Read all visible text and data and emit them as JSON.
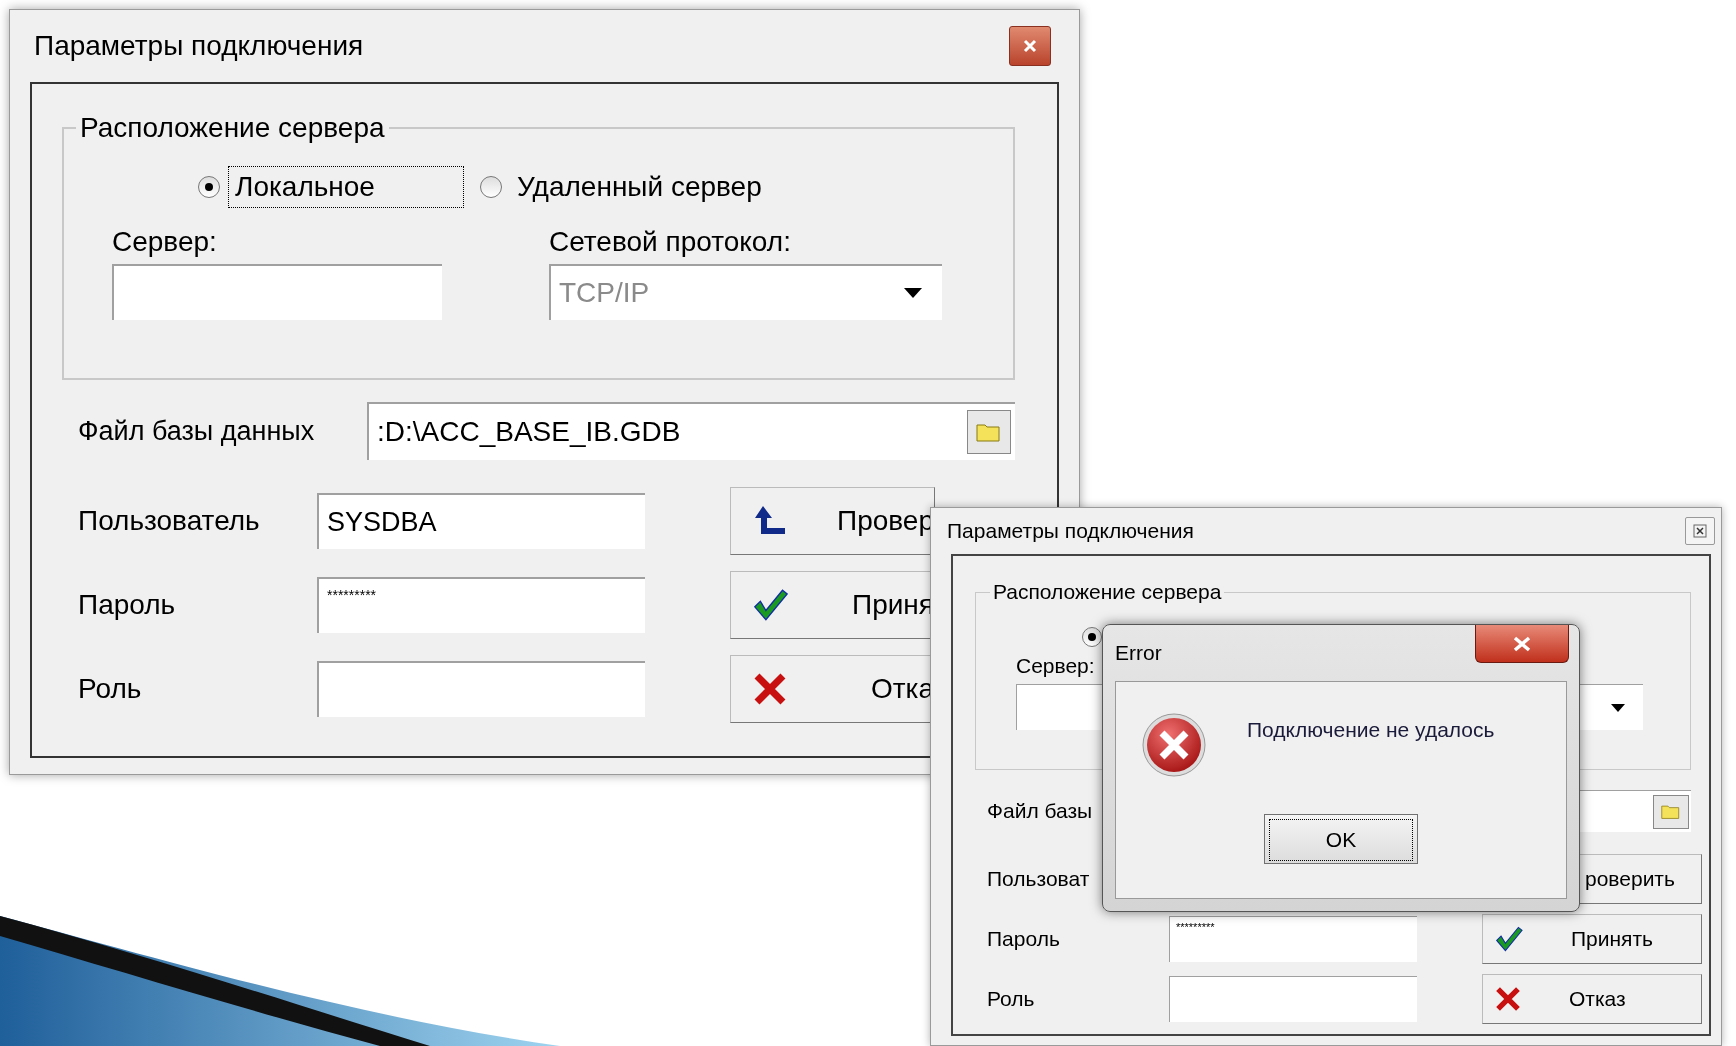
{
  "windows": [
    {
      "title": "Параметры подключения",
      "group_title": "Расположение сервера",
      "location_options": [
        {
          "label": "Локальное",
          "selected": true
        },
        {
          "label": "Удаленный сервер",
          "selected": false
        }
      ],
      "server_label": "Сервер:",
      "protocol_label": "Сетевой протокол:",
      "protocol_value": "TCP/IP",
      "db_file_label": "Файл базы данных",
      "db_file_value": ":D:\\ACC_BASE_IB.GDB",
      "fields": [
        {
          "label": "Пользователь",
          "value": "SYSDBA"
        },
        {
          "label": "Пароль",
          "value": "*********"
        },
        {
          "label": "Роль"
        }
      ],
      "buttons": [
        {
          "kind": "check",
          "label": "Провер"
        },
        {
          "kind": "accept",
          "label": "Приня"
        },
        {
          "kind": "cancel",
          "label": "Отка"
        }
      ]
    },
    {
      "title": "Параметры подключения",
      "group_title": "Расположение сервера",
      "location_options": [
        {
          "selected": true
        }
      ],
      "server_label": "Сервер:",
      "db_file_label": "Файл базы",
      "fields": [
        {
          "label": "Пользоват"
        },
        {
          "label": "Пароль",
          "value": "*********"
        },
        {
          "label": "Роль"
        }
      ],
      "buttons": [
        {
          "kind": "check",
          "label": "роверить"
        },
        {
          "kind": "accept",
          "label": "Принять"
        },
        {
          "kind": "cancel",
          "label": "Отказ"
        }
      ]
    }
  ],
  "error_dialog": {
    "title": "Error",
    "message": "Подключение не удалось",
    "button": "OK"
  }
}
